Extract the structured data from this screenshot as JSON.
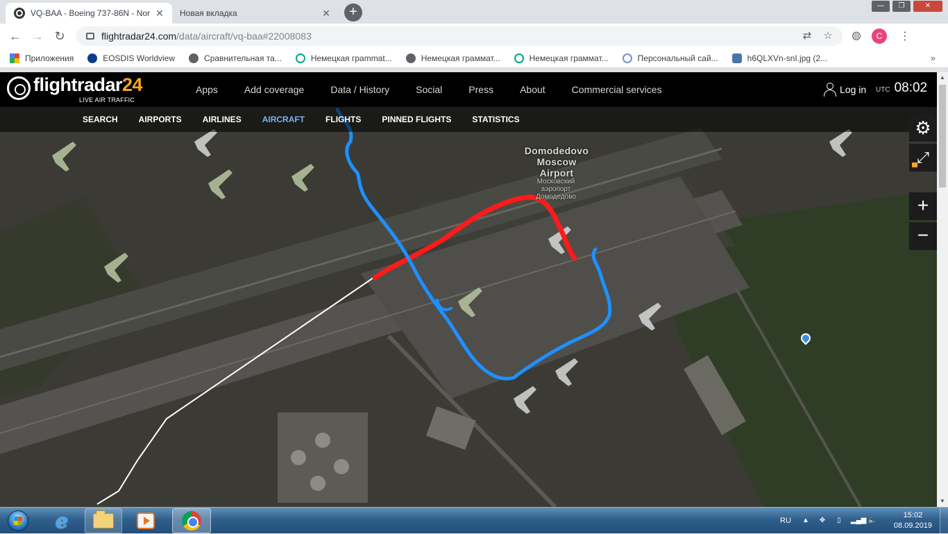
{
  "browser": {
    "tabs": [
      {
        "title": "VQ-BAA - Boeing 737-86N - Nor",
        "active": true
      },
      {
        "title": "Новая вкладка",
        "active": false
      }
    ],
    "url_host": "flightradar24.com",
    "url_path": "/data/aircraft/vq-baa#22008083",
    "profile_initial": "C",
    "bookmarks": [
      {
        "label": "Приложения",
        "icon": "apps-grid-icon"
      },
      {
        "label": "EOSDIS Worldview",
        "icon": "nasa-icon"
      },
      {
        "label": "Сравнительная та...",
        "icon": "globe-icon"
      },
      {
        "label": "Немецкая грammat...",
        "icon": "a-letter-icon"
      },
      {
        "label": "Немецкая граммат...",
        "icon": "globe-icon"
      },
      {
        "label": "Немецкая граммат...",
        "icon": "a-letter-icon"
      },
      {
        "label": "Персональный сай...",
        "icon": "bubble-icon"
      },
      {
        "label": "h6QLXVn-snI.jpg (2...",
        "icon": "vk-icon"
      }
    ]
  },
  "site": {
    "logo_main": "flightradar",
    "logo_accent": "24",
    "logo_sub": "LIVE AIR TRAFFIC",
    "nav": [
      "Apps",
      "Add coverage",
      "Data / History",
      "Social",
      "Press",
      "About",
      "Commercial services"
    ],
    "login_label": "Log in",
    "utc_label": "UTC",
    "utc_time": "08:02",
    "subnav": [
      {
        "label": "SEARCH",
        "active": false
      },
      {
        "label": "AIRPORTS",
        "active": false
      },
      {
        "label": "AIRLINES",
        "active": false
      },
      {
        "label": "AIRCRAFT",
        "active": true
      },
      {
        "label": "FLIGHTS",
        "active": false
      },
      {
        "label": "PINNED FLIGHTS",
        "active": false
      },
      {
        "label": "STATISTICS",
        "active": false
      }
    ]
  },
  "map": {
    "airport_name_en": [
      "Domodedovo",
      "Moscow",
      "Airport"
    ],
    "airport_name_ru": [
      "Московский",
      "аэропорт",
      "Домодедово"
    ],
    "track_colors": {
      "flight_path": "#ffffff",
      "red_trace": "#ff1a1a",
      "blue_trace": "#1e90ff"
    }
  },
  "taskbar": {
    "language": "RU",
    "time": "15:02",
    "date": "08.09.2019"
  },
  "colors": {
    "fr24_accent": "#f5a623",
    "subnav_active": "#74b7ef",
    "header_bg": "#000000"
  }
}
